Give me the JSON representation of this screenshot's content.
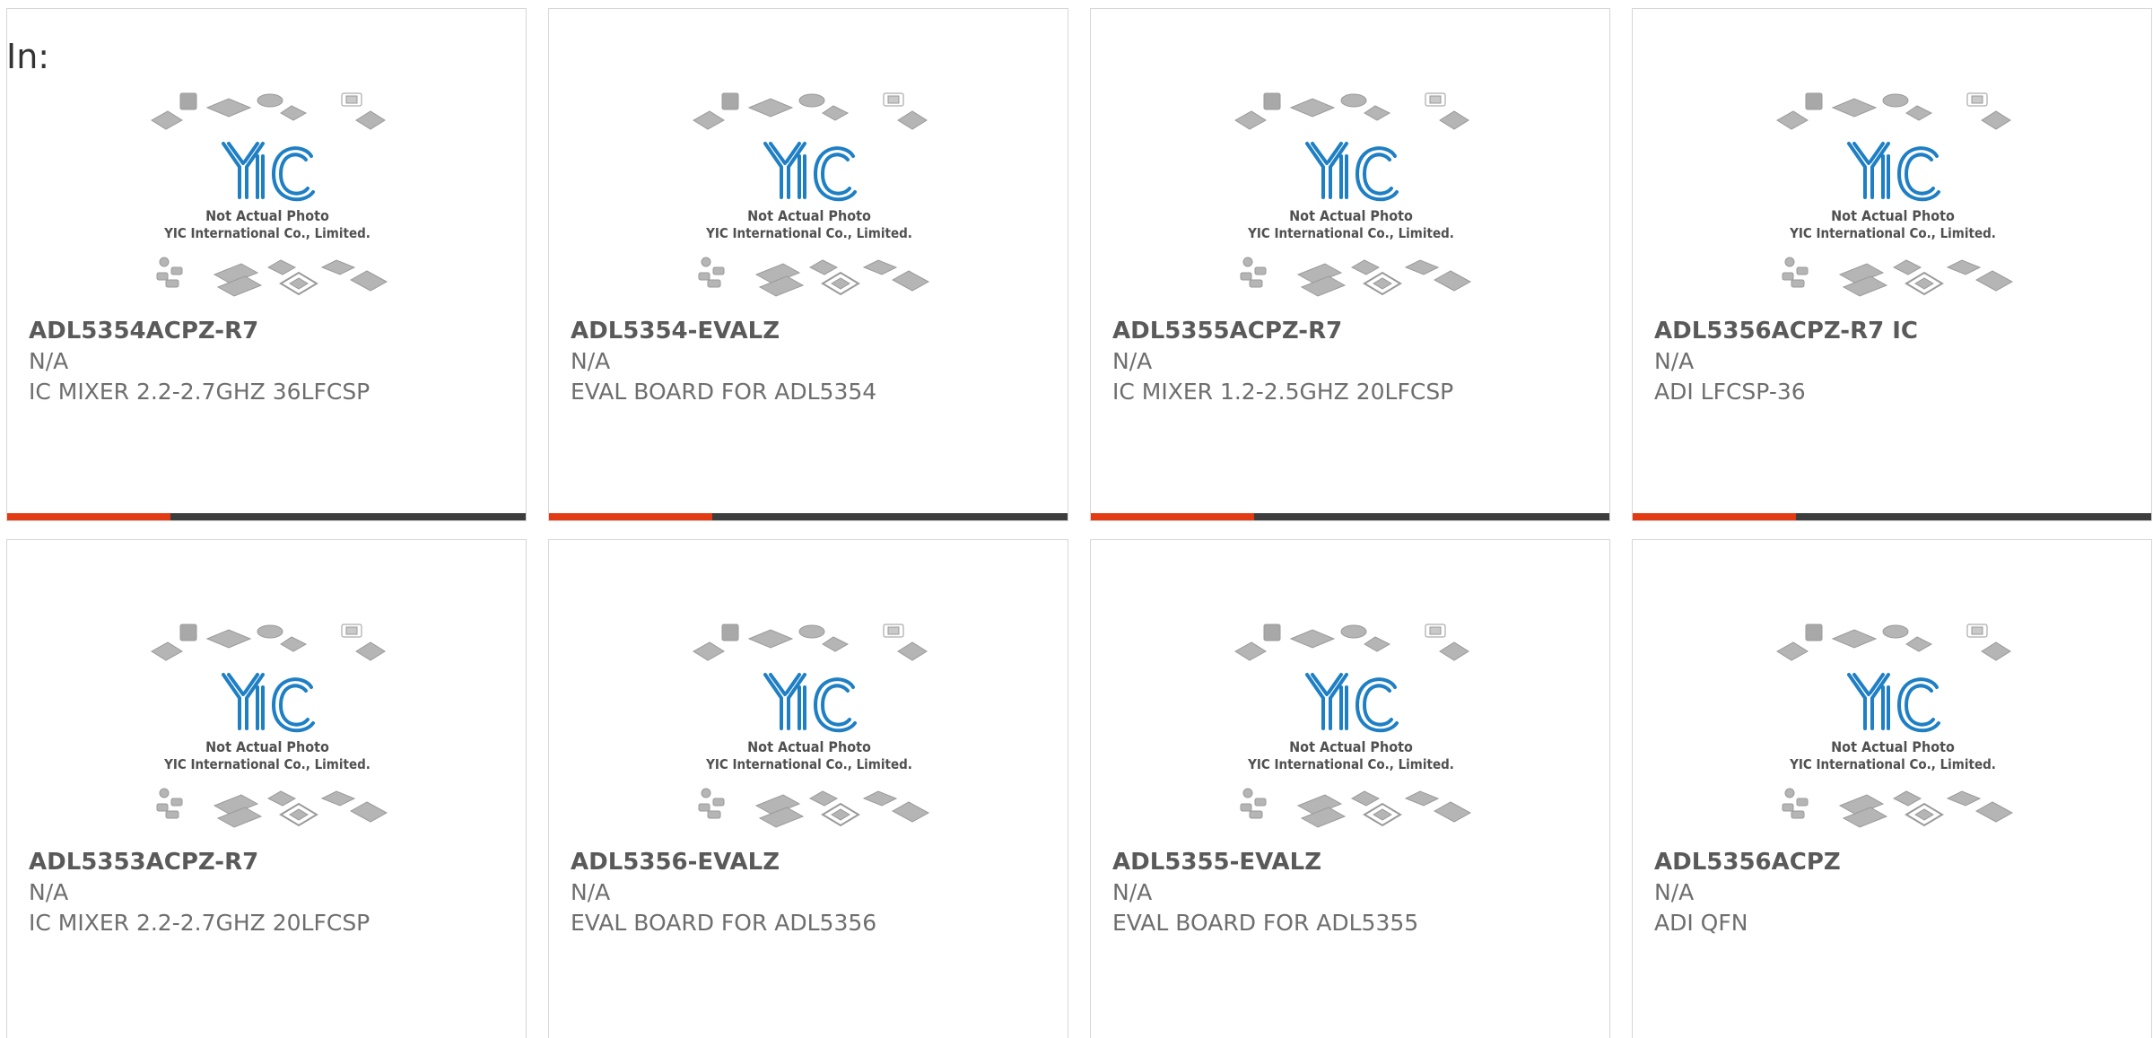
{
  "page": {
    "filter_label": "In:"
  },
  "colors": {
    "accent": "#e23a12",
    "bar_dark": "#3d3d3d",
    "logo_blue": "#1f7fc4"
  },
  "placeholder_image": {
    "line1": "Not Actual Photo",
    "line2": "YIC International Co., Limited.",
    "logo_text": "YIC"
  },
  "products": [
    {
      "part_number": "ADL5354ACPZ-R7",
      "manufacturer": "N/A",
      "description": "IC MIXER 2.2-2.7GHZ 36LFCSP"
    },
    {
      "part_number": "ADL5354-EVALZ",
      "manufacturer": "N/A",
      "description": "EVAL BOARD FOR ADL5354"
    },
    {
      "part_number": "ADL5355ACPZ-R7",
      "manufacturer": "N/A",
      "description": "IC MIXER 1.2-2.5GHZ 20LFCSP"
    },
    {
      "part_number": "ADL5356ACPZ-R7 IC",
      "manufacturer": "N/A",
      "description": "ADI LFCSP-36"
    },
    {
      "part_number": "ADL5353ACPZ-R7",
      "manufacturer": "N/A",
      "description": "IC MIXER 2.2-2.7GHZ 20LFCSP"
    },
    {
      "part_number": "ADL5356-EVALZ",
      "manufacturer": "N/A",
      "description": "EVAL BOARD FOR ADL5356"
    },
    {
      "part_number": "ADL5355-EVALZ",
      "manufacturer": "N/A",
      "description": "EVAL BOARD FOR ADL5355"
    },
    {
      "part_number": "ADL5356ACPZ",
      "manufacturer": "N/A",
      "description": "ADI QFN"
    }
  ]
}
